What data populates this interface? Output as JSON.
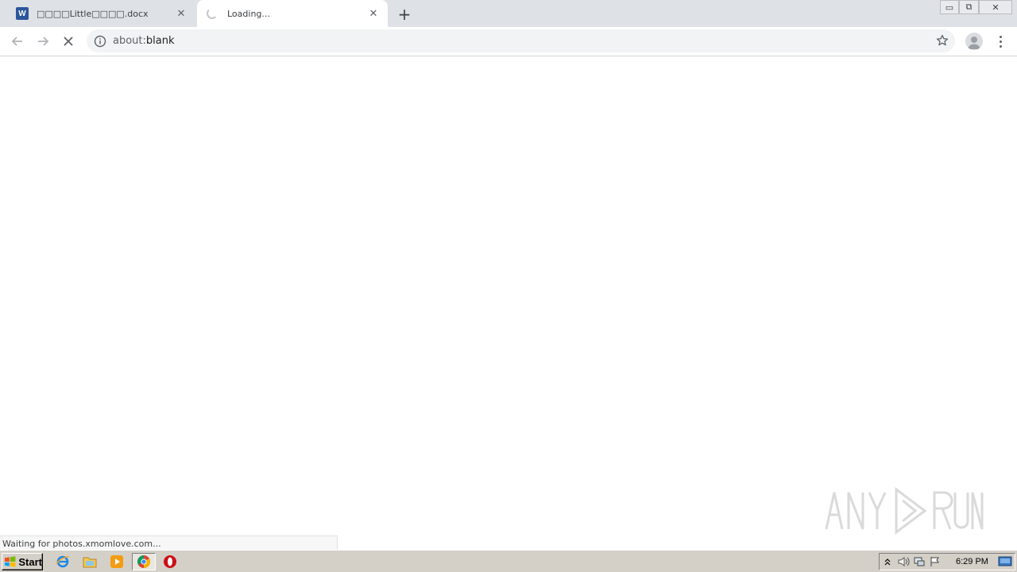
{
  "tabs": [
    {
      "title": "□□□□Little□□□□.docx",
      "icon": "word-icon",
      "active": false,
      "close": "✕"
    },
    {
      "title": "Loading...",
      "icon": "loading-spinner-icon",
      "active": true,
      "close": "✕"
    }
  ],
  "new_tab_label": "+",
  "window_controls": {
    "minimize": "▭",
    "maximize": "⧉",
    "close": "✕"
  },
  "address_bar": {
    "scheme": "about:",
    "path": "blank"
  },
  "status_bubble": "Waiting for photos.xmomlove.com...",
  "taskbar": {
    "start_label": "Start",
    "clock": "6:29 PM",
    "apps": [
      "internet-explorer-icon",
      "file-explorer-icon",
      "media-player-icon",
      "chrome-icon",
      "opera-icon"
    ]
  },
  "colors": {
    "tabstrip": "#dee1e6",
    "omnibox": "#f1f3f4",
    "taskbar": "#d4d0c8",
    "word_blue": "#2b579a"
  }
}
